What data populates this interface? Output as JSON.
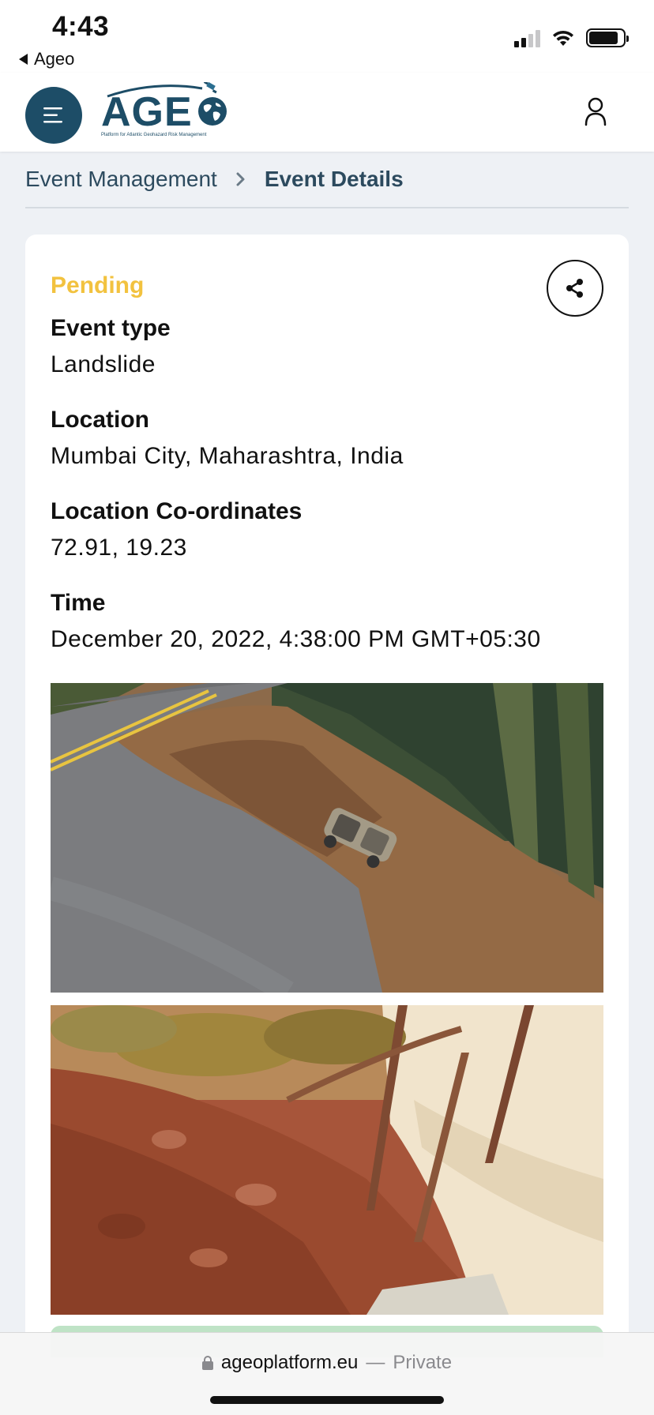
{
  "status_bar": {
    "time": "4:43",
    "back_label": "Ageo"
  },
  "header": {
    "logo_text": "AGE",
    "logo_subtitle": "Platform for Atlantic Geohazard Risk Management",
    "menu_icon": "hamburger-icon",
    "user_icon": "user-icon"
  },
  "breadcrumb": {
    "parent": "Event Management",
    "separator": "›",
    "current": "Event Details"
  },
  "event": {
    "status": "Pending",
    "status_color": "#f2c23f",
    "fields": [
      {
        "label": "Event type",
        "value": "Landslide"
      },
      {
        "label": "Location",
        "value": "Mumbai City, Maharashtra, India"
      },
      {
        "label": "Location Co-ordinates",
        "value": "72.91, 19.23"
      },
      {
        "label": "Time",
        "value": "December 20, 2022, 4:38:00 PM GMT+05:30"
      }
    ],
    "share_icon": "share-icon"
  },
  "safari": {
    "url": "ageoplatform.eu",
    "separator": "—",
    "mode": "Private"
  },
  "colors": {
    "brand": "#1d4d67",
    "background": "#eef1f5"
  }
}
